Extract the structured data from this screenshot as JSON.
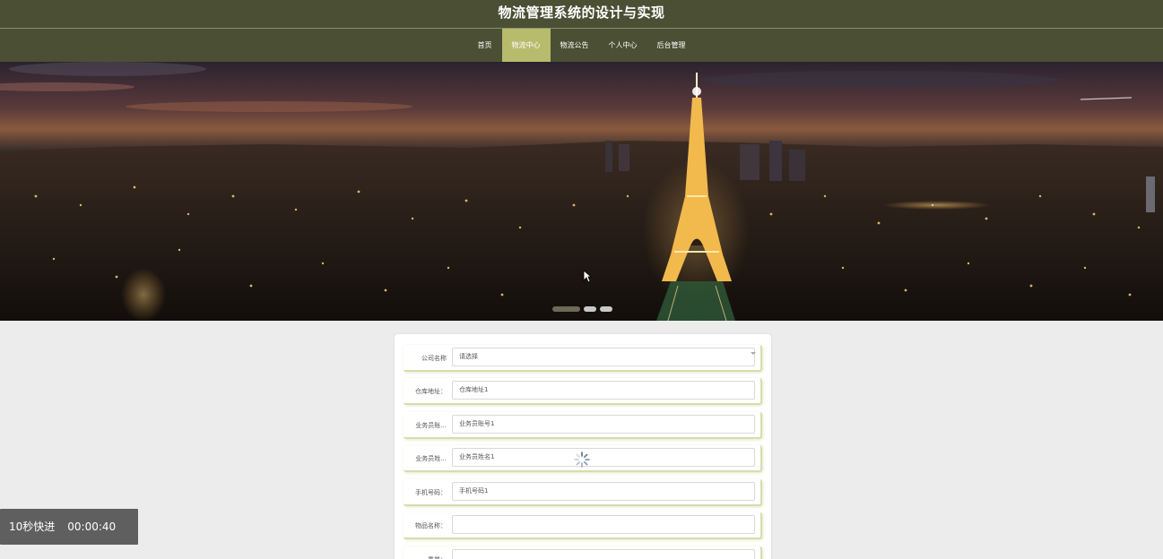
{
  "header": {
    "title": "物流管理系统的设计与实现"
  },
  "nav": {
    "items": [
      {
        "label": "首页"
      },
      {
        "label": "物流中心"
      },
      {
        "label": "物流公告"
      },
      {
        "label": "个人中心"
      },
      {
        "label": "后台管理"
      }
    ],
    "active_index": 1
  },
  "carousel": {
    "slide_count": 3,
    "active_index": 0
  },
  "form": {
    "fields": [
      {
        "label": "公司名称",
        "value": "请选择",
        "type": "select"
      },
      {
        "label": "仓库地址：",
        "value": "仓库地址1",
        "type": "text"
      },
      {
        "label": "业务员账...",
        "value": "业务员账号1",
        "type": "text"
      },
      {
        "label": "业务员姓...",
        "value": "业务员姓名1",
        "type": "text"
      },
      {
        "label": "手机号码：",
        "value": "手机号码1",
        "type": "text"
      },
      {
        "label": "物品名称：",
        "value": "",
        "type": "text"
      },
      {
        "label": "重量：",
        "value": "",
        "type": "text"
      }
    ]
  },
  "video_overlay": {
    "speed_label": "10秒快进",
    "time": "00:00:40"
  },
  "colors": {
    "header_bg": "#4b4f33",
    "nav_active_bg": "#b7bb6c",
    "page_bg": "#ececec",
    "row_border": "#d6dda8"
  }
}
